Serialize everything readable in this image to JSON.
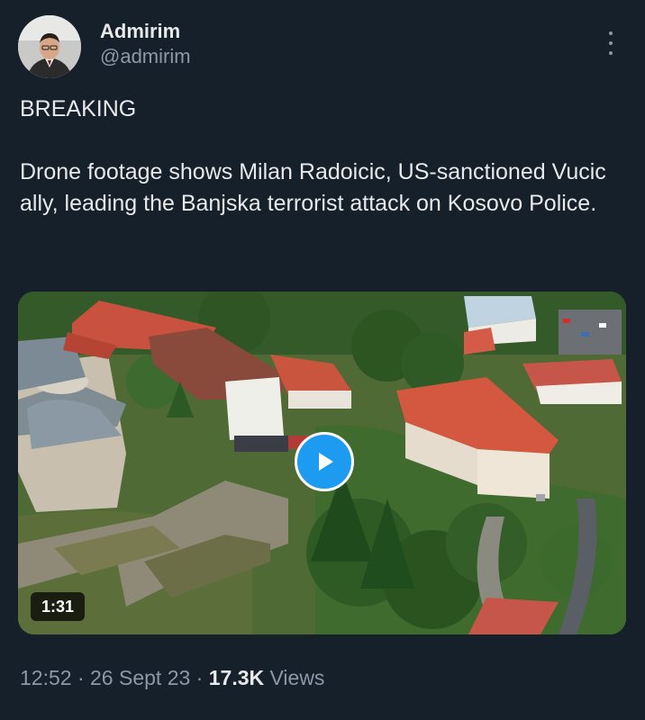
{
  "theme": {
    "background": "#15202b",
    "text": "#e7e9ea",
    "muted": "#8b98a5",
    "accent": "#1d9bf0"
  },
  "author": {
    "display_name": "Admirim",
    "handle": "@admirim",
    "avatar_icon": "profile-photo",
    "more_icon": "more-vertical-icon"
  },
  "tweet": {
    "lines": [
      "BREAKING",
      "Drone footage shows Milan Radoicic, US-sanctioned Vucic ally, leading the Banjska terrorist attack on Kosovo Police."
    ]
  },
  "media": {
    "type": "video",
    "duration": "1:31",
    "play_icon": "play-icon",
    "description_icon": "drone-aerial-monastery-village"
  },
  "meta": {
    "time": "12:52",
    "separator": "·",
    "date": "26 Sept 23",
    "views_count": "17.3K",
    "views_label": "Views"
  }
}
